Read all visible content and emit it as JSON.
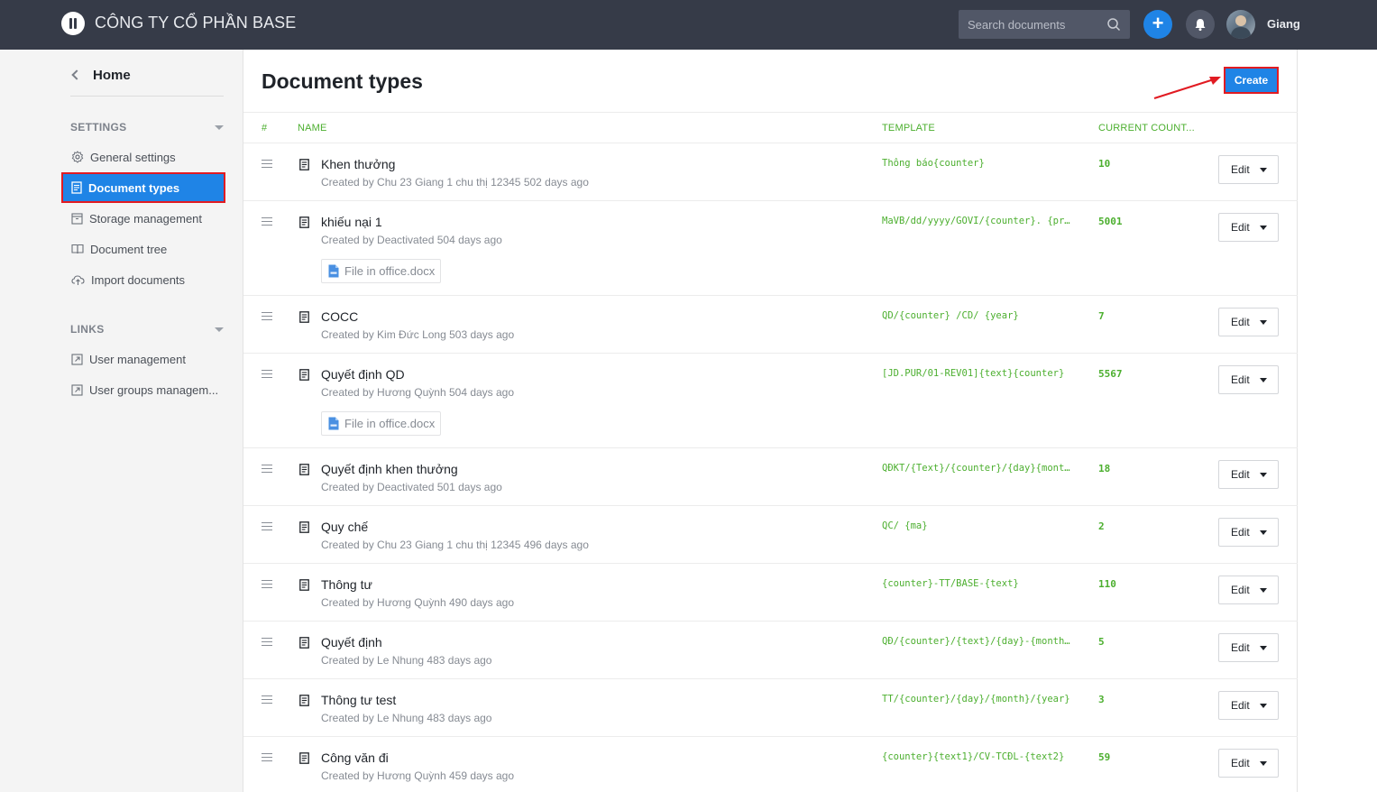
{
  "header": {
    "company": "CÔNG TY CỔ PHẦN BASE",
    "search_placeholder": "Search documents",
    "username": "Giang",
    "accent": "#1f84e6",
    "bg": "#363b48"
  },
  "sidebar": {
    "home": "Home",
    "settings_title": "SETTINGS",
    "settings_items": [
      {
        "label": "General settings",
        "icon": "gear-icon"
      },
      {
        "label": "Document types",
        "icon": "document-icon",
        "active": true
      },
      {
        "label": "Storage management",
        "icon": "storage-icon"
      },
      {
        "label": "Document tree",
        "icon": "book-icon"
      },
      {
        "label": "Import documents",
        "icon": "cloud-upload-icon"
      }
    ],
    "links_title": "LINKS",
    "links_items": [
      {
        "label": "User management",
        "icon": "external-link-icon"
      },
      {
        "label": "User groups managem...",
        "icon": "external-link-icon"
      }
    ]
  },
  "main": {
    "title": "Document types",
    "create_label": "Create",
    "columns": {
      "index": "#",
      "name": "NAME",
      "template": "TEMPLATE",
      "count": "CURRENT COUNT..."
    },
    "edit_label": "Edit",
    "rows": [
      {
        "name": "Khen thưởng",
        "meta": "Created by Chu 23 Giang 1 chu thị 12345 502 days ago",
        "template": "Thông báo{counter}",
        "count": "10"
      },
      {
        "name": "khiếu nại 1",
        "meta": "Created by Deactivated 504 days ago",
        "template": "MaVB/dd/yyyy/GOVI/{counter}. {pr…",
        "count": "5001",
        "attachment": "File in office.docx"
      },
      {
        "name": "COCC",
        "meta": "Created by Kim Đức Long 503 days ago",
        "template": "QD/{counter} /CD/ {year}",
        "count": "7"
      },
      {
        "name": "Quyết định QD",
        "meta": "Created by Hương Quỳnh 504 days ago",
        "template": "[JD.PUR/01-REV01]{text}{counter}",
        "count": "5567",
        "attachment": "File in office.docx"
      },
      {
        "name": "Quyết định khen thưởng",
        "meta": "Created by Deactivated 501 days ago",
        "template": "QĐKT/{Text}/{counter}/{day}{mont…",
        "count": "18"
      },
      {
        "name": "Quy chế",
        "meta": "Created by Chu 23 Giang 1 chu thị 12345 496 days ago",
        "template": "QC/ {ma}",
        "count": "2"
      },
      {
        "name": "Thông tư",
        "meta": "Created by Hương Quỳnh 490 days ago",
        "template": "{counter}-TT/BASE-{text}",
        "count": "110"
      },
      {
        "name": "Quyết định",
        "meta": "Created by Le Nhung 483 days ago",
        "template": "QĐ/{counter}/{text}/{day}-{month…",
        "count": "5"
      },
      {
        "name": "Thông tư test",
        "meta": "Created by Le Nhung 483 days ago",
        "template": "TT/{counter}/{day}/{month}/{year}",
        "count": "3"
      },
      {
        "name": "Công văn đi",
        "meta": "Created by Hương Quỳnh 459 days ago",
        "template": "{counter}{text1}/CV-TCĐL-{text2}",
        "count": "59"
      }
    ]
  }
}
